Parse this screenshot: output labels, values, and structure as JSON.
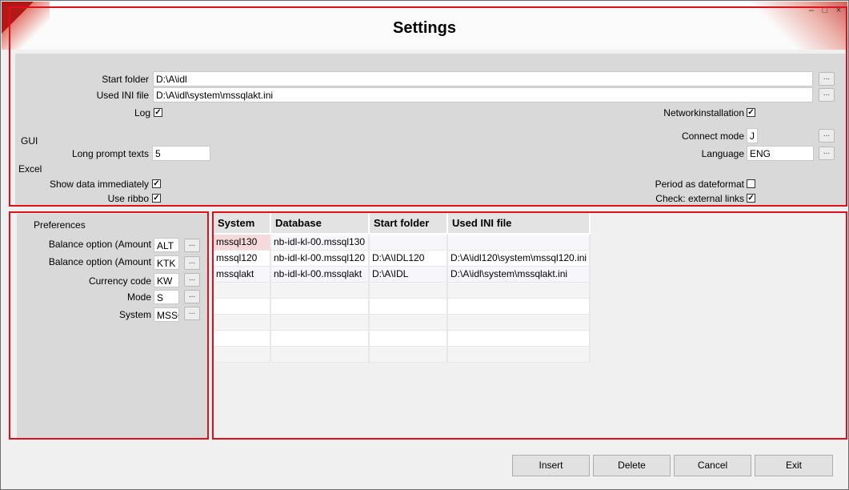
{
  "window": {
    "title": "Settings",
    "controls": {
      "minimize": "–",
      "maximize": "□",
      "close": "×"
    }
  },
  "settings": {
    "start_folder_label": "Start folder",
    "start_folder_value": "D:\\A\\idl",
    "used_ini_label": "Used INI file",
    "used_ini_value": "D:\\A\\idl\\system\\mssqlakt.ini",
    "log_label": "Log",
    "log_checked": true,
    "network_label": "Networkinstallation",
    "network_checked": true,
    "gui_header": "GUI",
    "long_prompt_label": "Long prompt texts",
    "long_prompt_value": "5",
    "connect_mode_label": "Connect mode",
    "connect_mode_value": "J",
    "language_label": "Language",
    "language_value": "ENG",
    "excel_header": "Excel",
    "show_data_label": "Show data immediately",
    "show_data_checked": true,
    "period_label": "Period as dateformat",
    "period_checked": false,
    "use_ribbon_label": "Use ribbo",
    "use_ribbon_checked": true,
    "external_links_label": "Check: external links",
    "external_links_checked": true,
    "browse_label": "..."
  },
  "preferences": {
    "title": "Preferences",
    "items": [
      {
        "label": "Balance option (Amount",
        "value": "ALT"
      },
      {
        "label": "Balance option (Amount",
        "value": "KTK"
      },
      {
        "label": "Currency code",
        "value": "KW"
      },
      {
        "label": "Mode",
        "value": "S"
      },
      {
        "label": "System",
        "value": "MSSQ"
      }
    ]
  },
  "grid": {
    "columns": [
      "System",
      "Database",
      "Start folder",
      "Used INI file"
    ],
    "rows": [
      {
        "system": "mssql130",
        "database": "nb-idl-kl-00.mssql130",
        "start_folder": "",
        "ini_file": ""
      },
      {
        "system": "mssql120",
        "database": "nb-idl-kl-00.mssql120",
        "start_folder": "D:\\A\\IDL120",
        "ini_file": "D:\\A\\idl120\\system\\mssql120.ini"
      },
      {
        "system": "mssqlakt",
        "database": "nb-idl-kl-00.mssqlakt",
        "start_folder": "D:\\A\\IDL",
        "ini_file": "D:\\A\\idl\\system\\mssqlakt.ini"
      }
    ],
    "selected_row": 0
  },
  "buttons": {
    "insert": "Insert",
    "delete": "Delete",
    "cancel": "Cancel",
    "exit": "Exit"
  },
  "colors": {
    "highlight_frame": "#e0101a",
    "brand_red": "#b31818"
  },
  "icons": {
    "browse": "ellipsis-icon",
    "checkbox_checked": "checkmark-icon"
  }
}
